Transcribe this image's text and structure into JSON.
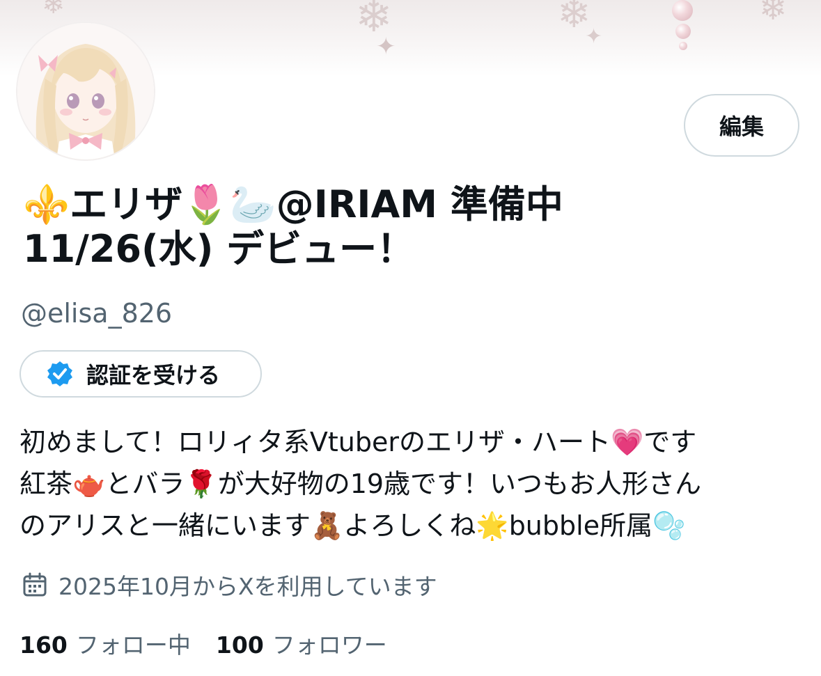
{
  "profile": {
    "edit_label": "編集",
    "display_name_line1": {
      "icon1": "⚜️",
      "name": "エリザ",
      "icon2": "🌷",
      "icon3": "🦢",
      "suffix": "@IRIAM 準備中"
    },
    "display_name_line2": "11/26(水) デビュー！",
    "handle": "@elisa_826",
    "verify_label": "認証を受ける",
    "bio": {
      "line1_text": "初めまして！ロリィタ系Vtuberのエリザ・ハート",
      "line1_emoji": "💗",
      "line1_end": "です",
      "line2_a": "紅茶",
      "line2_emoji1": "🫖",
      "line2_b": "とバラ",
      "line2_emoji2": "🌹",
      "line2_c": "が大好物の19歳です！いつもお人形さん",
      "line3_a": "のアリスと一緒にいます",
      "line3_emoji1": "🧸",
      "line3_b": "よろしくね",
      "line3_emoji2": "🌟",
      "line3_c": "bubble所属",
      "line3_emoji3": "🫧"
    },
    "joined": "2025年10月からXを利用しています",
    "following_count": "160",
    "following_label": "フォロー中",
    "followers_count": "100",
    "followers_label": "フォロワー"
  },
  "icons": {
    "calendar": "calendar-icon",
    "verified": "verified-badge-icon",
    "avatar": "avatar-image"
  },
  "colors": {
    "text_primary": "#0f1419",
    "text_secondary": "#536471",
    "border": "#cfd9de",
    "verified_blue": "#1d9bf0"
  }
}
